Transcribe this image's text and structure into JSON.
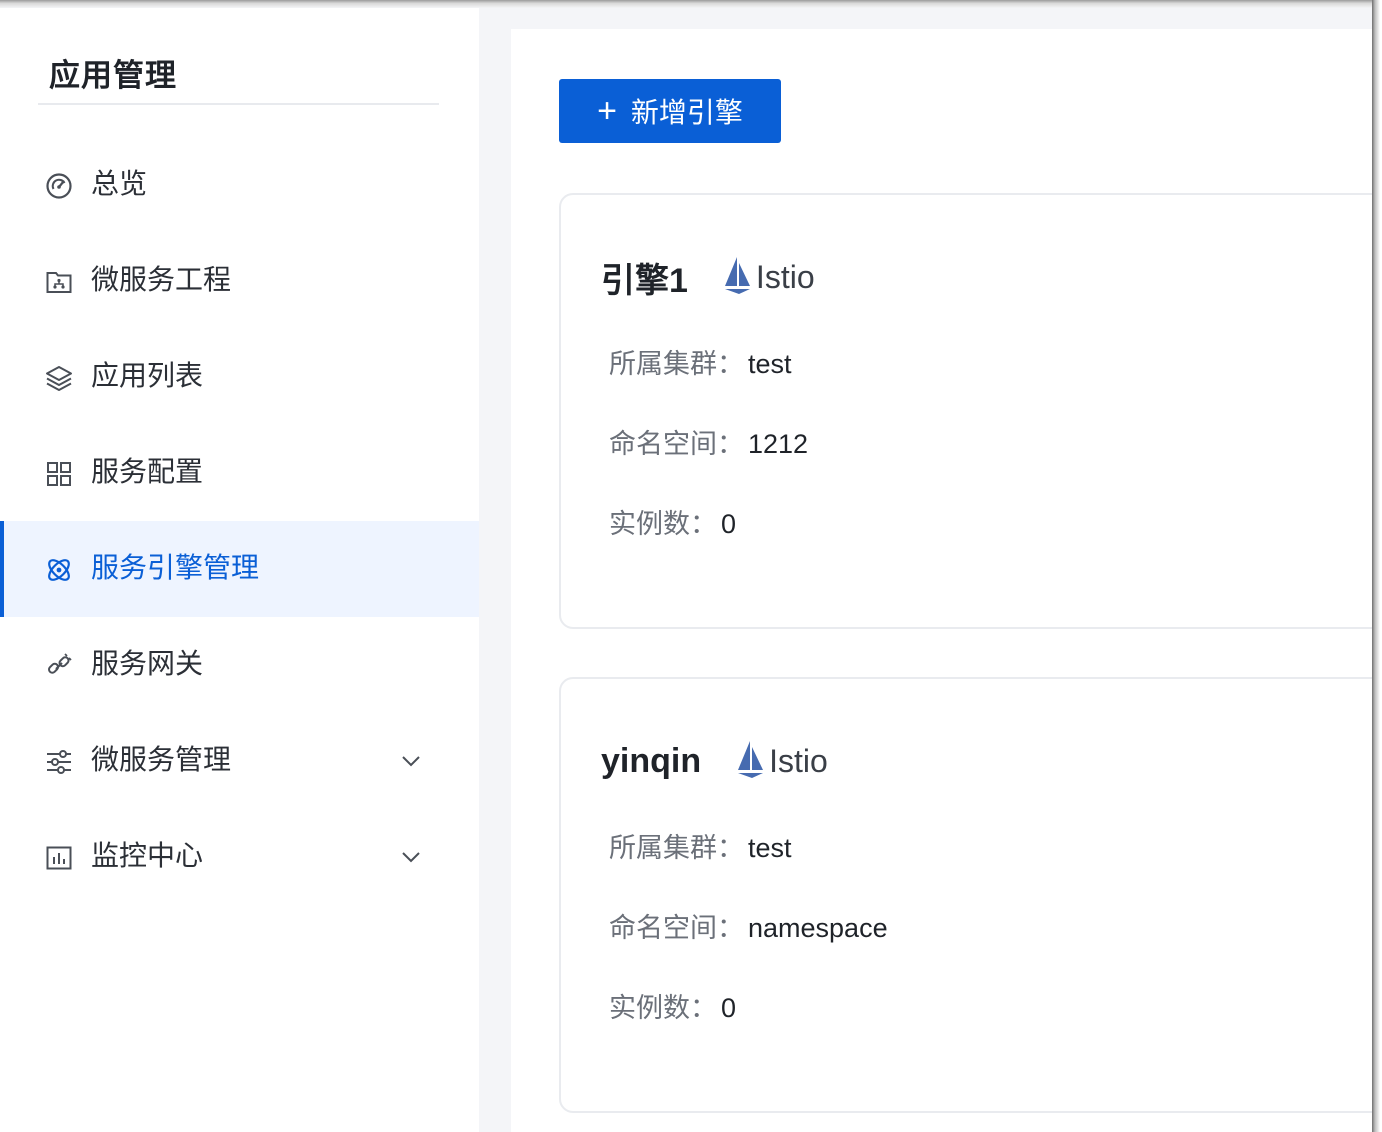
{
  "sidebar": {
    "title": "应用管理",
    "items": [
      {
        "label": "总览",
        "icon": "dashboard-icon"
      },
      {
        "label": "微服务工程",
        "icon": "project-folder-icon"
      },
      {
        "label": "应用列表",
        "icon": "layers-icon"
      },
      {
        "label": "服务配置",
        "icon": "grid-icon"
      },
      {
        "label": "服务引擎管理",
        "icon": "engine-icon",
        "active": true
      },
      {
        "label": "服务网关",
        "icon": "gateway-link-icon"
      },
      {
        "label": "微服务管理",
        "icon": "sliders-icon",
        "expandable": true
      },
      {
        "label": "监控中心",
        "icon": "chart-icon",
        "expandable": true
      }
    ]
  },
  "main": {
    "add_button_label": "新增引擎",
    "cards": [
      {
        "name": "引擎1",
        "type_label": "Istio",
        "cluster_key": "所属集群：",
        "cluster_value": "test",
        "namespace_key": "命名空间：",
        "namespace_value": "1212",
        "instances_key": "实例数：",
        "instances_value": "0"
      },
      {
        "name": "yinqin",
        "type_label": "Istio",
        "cluster_key": "所属集群：",
        "cluster_value": "test",
        "namespace_key": "命名空间：",
        "namespace_value": "namespace",
        "instances_key": "实例数：",
        "instances_value": "0"
      }
    ]
  },
  "colors": {
    "accent": "#0a5fd6",
    "active_bg": "#eef4ff",
    "istio_sail": "#466bb0"
  }
}
